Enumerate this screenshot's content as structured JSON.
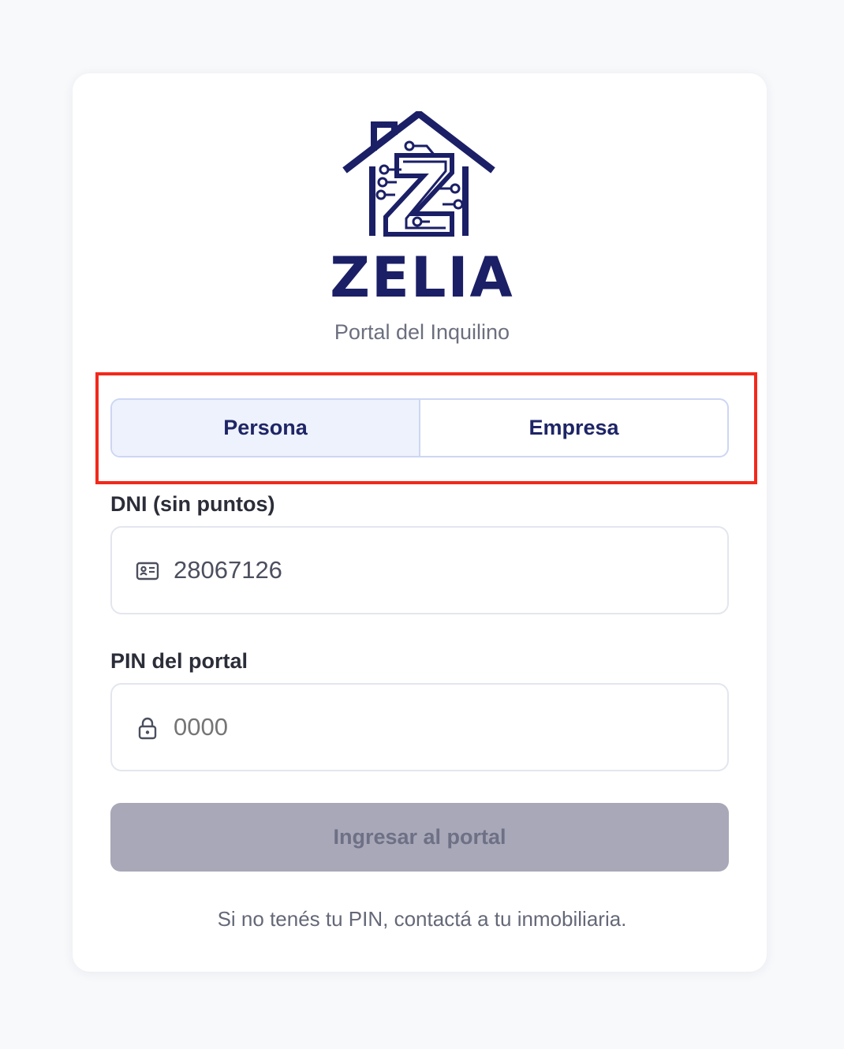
{
  "brand": {
    "name": "ZELIA",
    "subtitle": "Portal del Inquilino",
    "logo_icon": "house-circuit-z-icon",
    "color": "#1b1f66"
  },
  "account_type": {
    "options": [
      "Persona",
      "Empresa"
    ],
    "selected": "Persona"
  },
  "dni_field": {
    "label": "DNI (sin puntos)",
    "value": "28067126",
    "icon": "id-card-icon"
  },
  "pin_field": {
    "label": "PIN del portal",
    "placeholder": "0000",
    "value": "",
    "icon": "lock-icon"
  },
  "submit": {
    "label": "Ingresar al portal",
    "enabled": false
  },
  "footer_note": "Si no tenés tu PIN, contactá a tu inmobiliaria.",
  "colors": {
    "accent": "#1e2566",
    "highlight": "#f2291b",
    "disabled_button": "#a8a8b8"
  }
}
